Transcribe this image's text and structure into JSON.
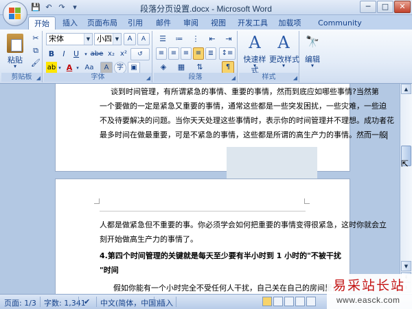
{
  "window": {
    "title": "段落分页设置.docx - Microsoft Word",
    "controls": {
      "minimize": "─",
      "maximize": "□",
      "close": "✕"
    }
  },
  "quick_access": {
    "save_icon": "save-icon",
    "undo_icon": "undo-icon",
    "redo_icon": "redo-icon",
    "customize_icon": "customize-icon"
  },
  "tabs": [
    {
      "label": "开始",
      "active": true
    },
    {
      "label": "插入",
      "active": false
    },
    {
      "label": "页面布局",
      "active": false
    },
    {
      "label": "引用",
      "active": false
    },
    {
      "label": "邮件",
      "active": false
    },
    {
      "label": "审阅",
      "active": false
    },
    {
      "label": "视图",
      "active": false
    },
    {
      "label": "开发工具",
      "active": false
    },
    {
      "label": "加载项",
      "active": false
    },
    {
      "label": "Community Clips",
      "active": false
    }
  ],
  "ribbon": {
    "clipboard": {
      "label": "剪贴板",
      "paste": "粘贴"
    },
    "font": {
      "label": "字体",
      "font_name": "宋体",
      "font_size": "小四",
      "grow": "A",
      "shrink": "A",
      "bold": "B",
      "italic": "I",
      "underline": "U",
      "strike": "abe",
      "subscript": "x₂",
      "superscript": "x²",
      "clear": "Aa",
      "font_color": "A",
      "char_border": "A",
      "char_shading": "字"
    },
    "paragraph": {
      "label": "段落"
    },
    "styles": {
      "label": "样式",
      "quick_styles": "快速样式",
      "change_styles": "更改样式"
    },
    "editing": {
      "label": "编辑"
    }
  },
  "document": {
    "page1_lines": [
      "谈到时间管理，有所谓紧急的事情、重要的事情，然而到底应如哪些事情?当然第",
      "一个要做的一定是紧急又重要的事情，通常这些都是一些突发困扰，一些灾难，一些迫",
      "不及待要解决的问题。当你天天处理这些事情时，表示你的时间管理并不理想。成功者花",
      "最多时间在做最重要，可是不紧急的事情，这些都是所谓的高生产力的事情。然而一般"
    ],
    "page2_lines": [
      "人都是做紧急但不重要的事。你必须学会如何把重要的事情变得很紧急，这时你就会立",
      "刻开始做高生产力的事情了。"
    ],
    "heading_line1": "4.第四个时间管理的关键就是每天至少要有半小时到 1 小时的\"不被干扰",
    "heading_line2": "\"时间",
    "para_start": "假如你能有一个小时完全不受任何人干扰，自己关在自己的房间里面，思"
  },
  "status": {
    "page": "页面: 1/3",
    "words": "字数: 1,341",
    "language": "中文(简体，中国)",
    "mode": "插入"
  },
  "logo": {
    "text": "易采站长站",
    "url": "www.easck.com"
  },
  "colors": {
    "accent": "#15428b",
    "ribbon_bg": "#dbe6f5",
    "logo_red": "#c41313"
  }
}
